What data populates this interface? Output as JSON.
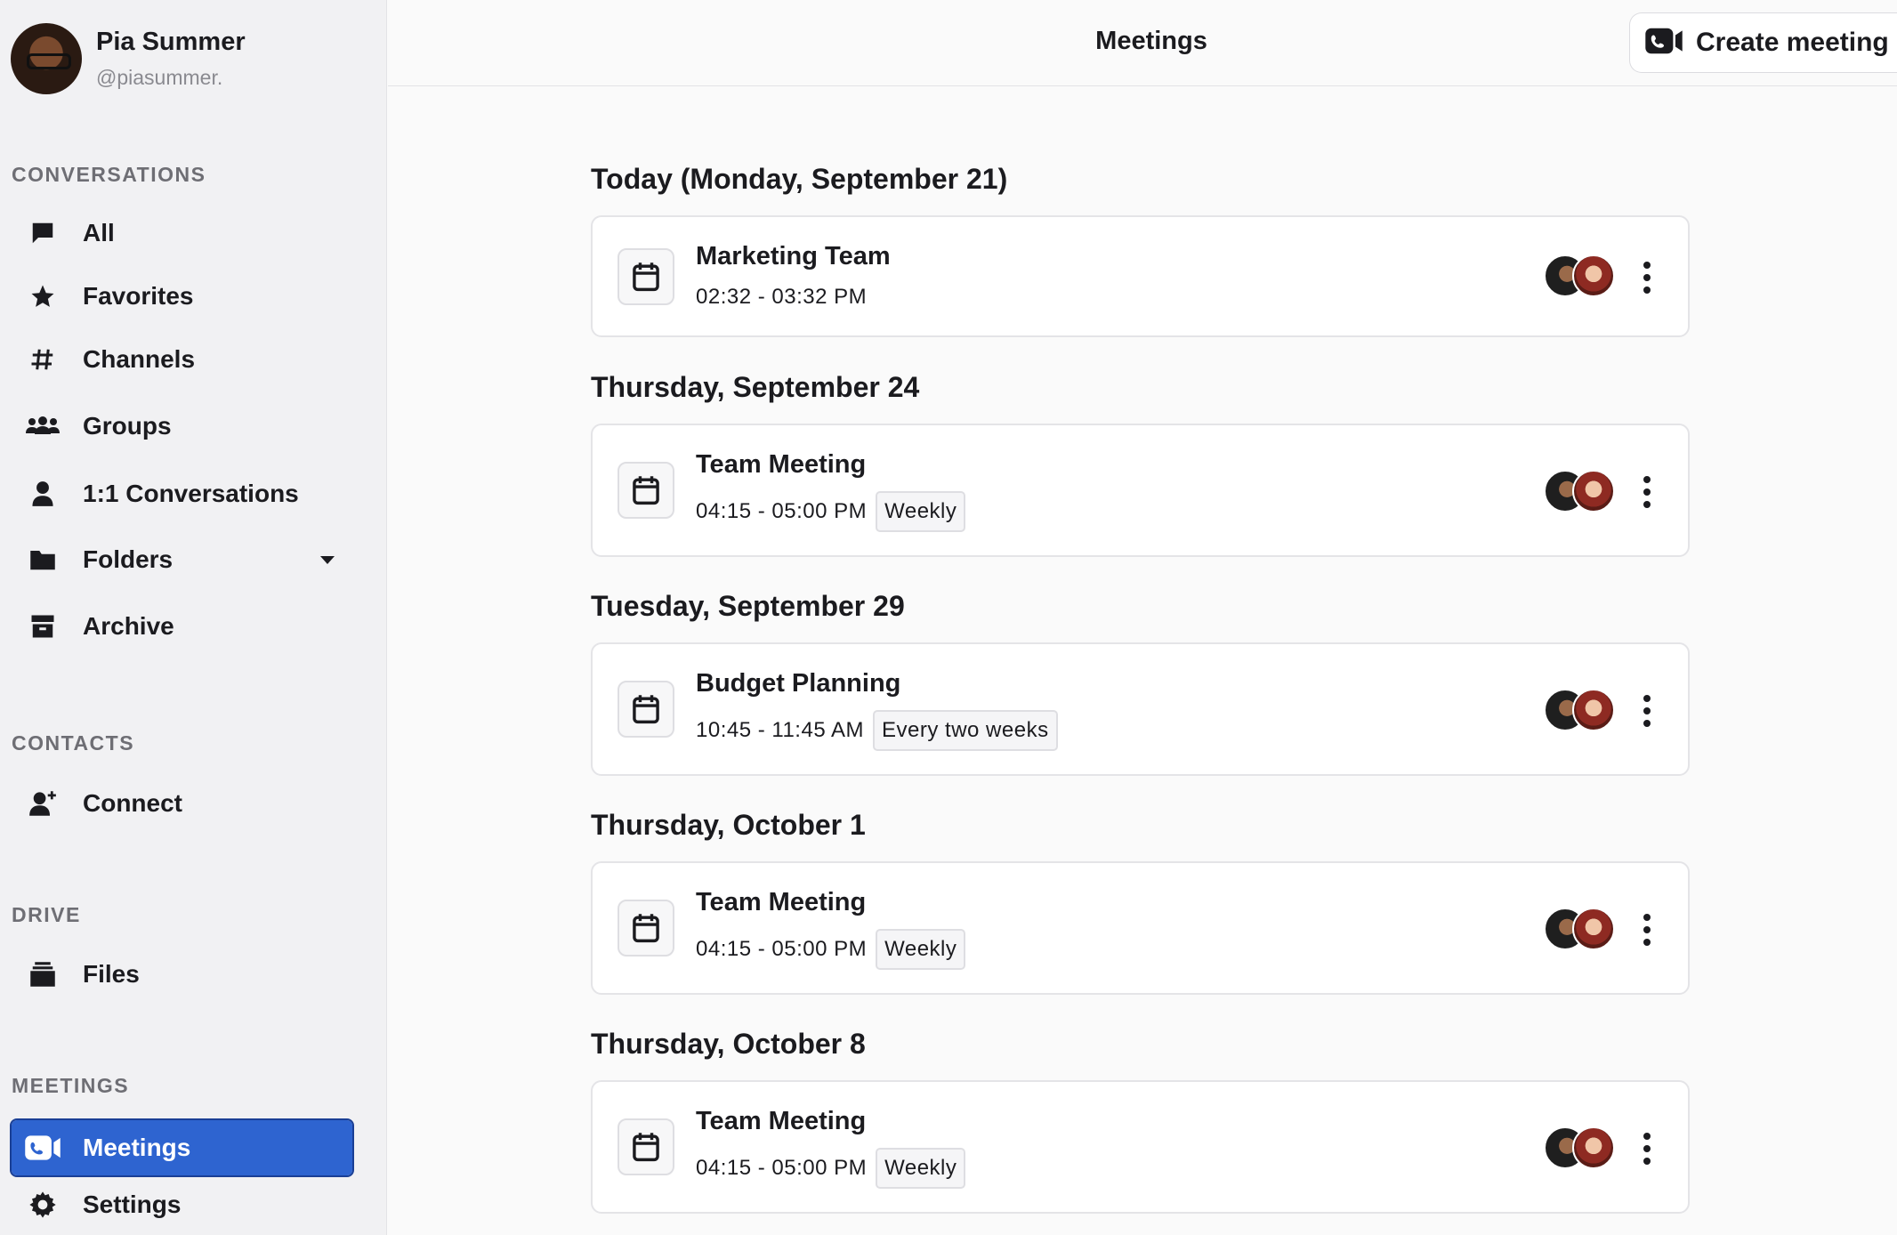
{
  "user": {
    "name": "Pia Summer",
    "handle": "@piasummer."
  },
  "sidebar": {
    "sections": {
      "conversations": "CONVERSATIONS",
      "contacts": "CONTACTS",
      "drive": "DRIVE",
      "meetings": "MEETINGS"
    },
    "items": [
      {
        "label": "All",
        "icon": "chat-bubble-icon"
      },
      {
        "label": "Favorites",
        "icon": "star-icon"
      },
      {
        "label": "Channels",
        "icon": "hash-icon"
      },
      {
        "label": "Groups",
        "icon": "group-icon"
      },
      {
        "label": "1:1 Conversations",
        "icon": "person-icon"
      },
      {
        "label": "Folders",
        "icon": "folder-icon"
      },
      {
        "label": "Archive",
        "icon": "archive-icon"
      },
      {
        "label": "Connect",
        "icon": "add-person-icon"
      },
      {
        "label": "Files",
        "icon": "files-icon"
      },
      {
        "label": "Meetings",
        "icon": "video-call-icon",
        "active": true
      },
      {
        "label": "Settings",
        "icon": "gear-icon"
      }
    ]
  },
  "header": {
    "title": "Meetings",
    "create_label": "Create meeting"
  },
  "days": [
    {
      "heading": "Today (Monday, September 21)",
      "meetings": [
        {
          "title": "Marketing Team",
          "time": "02:32 - 03:32 PM",
          "recurrence": ""
        }
      ]
    },
    {
      "heading": "Thursday, September 24",
      "meetings": [
        {
          "title": "Team Meeting",
          "time": "04:15 - 05:00 PM",
          "recurrence": "Weekly"
        }
      ]
    },
    {
      "heading": "Tuesday, September 29",
      "meetings": [
        {
          "title": "Budget Planning",
          "time": "10:45 - 11:45 AM",
          "recurrence": "Every two weeks"
        }
      ]
    },
    {
      "heading": "Thursday, October 1",
      "meetings": [
        {
          "title": "Team Meeting",
          "time": "04:15 - 05:00 PM",
          "recurrence": "Weekly"
        }
      ]
    },
    {
      "heading": "Thursday, October 8",
      "meetings": [
        {
          "title": "Team Meeting",
          "time": "04:15 - 05:00 PM",
          "recurrence": "Weekly"
        }
      ]
    }
  ],
  "colors": {
    "accent": "#2e64d0",
    "sidebar_bg": "#f1f1f3",
    "main_bg": "#fafafa"
  }
}
